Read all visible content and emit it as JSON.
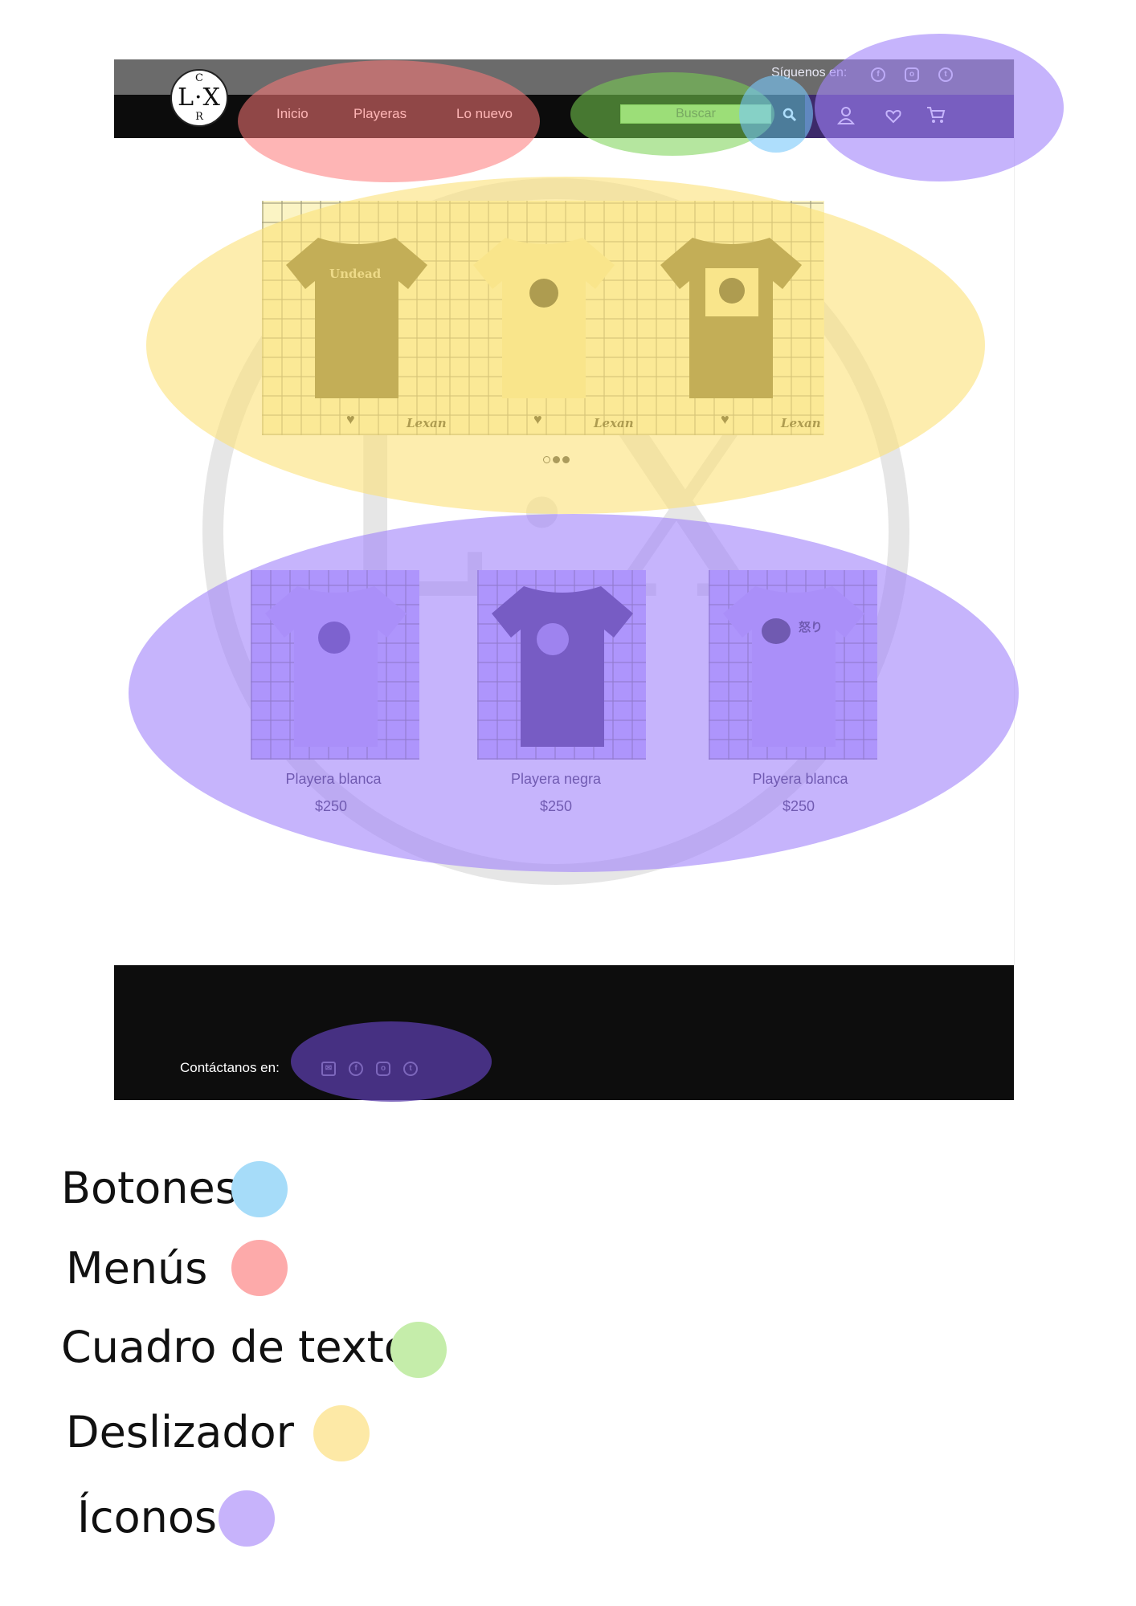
{
  "site": {
    "logo": {
      "center": "L·X",
      "top": "C",
      "bottom": "R"
    },
    "menu": [
      "Inicio",
      "Playeras",
      "Lo nuevo"
    ],
    "follow_label": "Síguenos en:",
    "social_icons": [
      "facebook-icon",
      "instagram-icon",
      "twitter-icon"
    ],
    "search_placeholder": "Buscar",
    "nav_icons": [
      "user-icon",
      "heart-icon",
      "cart-icon"
    ],
    "slider": {
      "slides": [
        {
          "print": "Undead",
          "brand": "Lexan",
          "shirt_color": "#6e6227"
        },
        {
          "print": "",
          "brand": "Lexan",
          "shirt_color": "#f6eca8"
        },
        {
          "print": "",
          "brand": "Lexan",
          "shirt_color": "#6e6227"
        }
      ],
      "dots": 3
    },
    "products": [
      {
        "name": "Playera blanca",
        "price": "$250",
        "shirt_color": "#b9a3f8"
      },
      {
        "name": "Playera negra",
        "price": "$250",
        "shirt_color": "#3b2574"
      },
      {
        "name": "Playera blanca",
        "price": "$250",
        "shirt_color": "#b9a3f8",
        "print": "怒り"
      }
    ],
    "contact_label": "Contáctanos en:",
    "contact_icons": [
      "mail-icon",
      "facebook-icon",
      "instagram-icon",
      "twitter-icon"
    ]
  },
  "legend": [
    {
      "label": "Botones",
      "color": "#a6dcf9"
    },
    {
      "label": "Menús",
      "color": "#fdaaaa"
    },
    {
      "label": "Cuadro de texto",
      "color": "#c5edaa"
    },
    {
      "label": "Deslizador",
      "color": "#fde9a6"
    },
    {
      "label": "Íconos",
      "color": "#c7b3fb"
    }
  ]
}
